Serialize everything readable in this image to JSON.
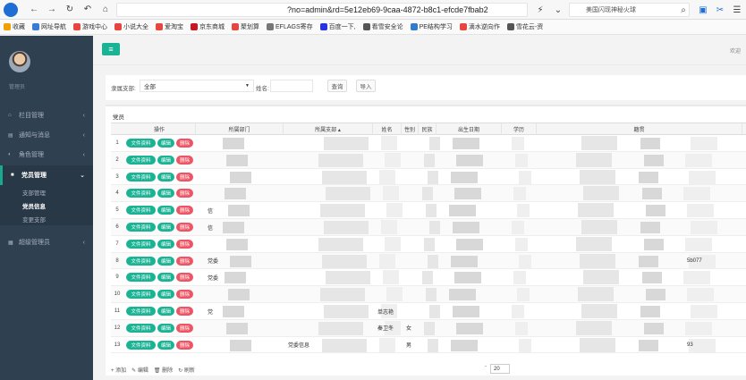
{
  "browser": {
    "address": "?no=admin&rd=5e12eb69-9caa-4872-b8c1-efcde7fbab2",
    "search_placeholder": "美国闪现神秘火球",
    "bookmarks": [
      {
        "label": "收藏",
        "color": "#f0a000"
      },
      {
        "label": "网址导航",
        "color": "#3a7bd5"
      },
      {
        "label": "游戏中心",
        "color": "#e8453c"
      },
      {
        "label": "小说大全",
        "color": "#e8453c"
      },
      {
        "label": "爱淘宝",
        "color": "#e8453c"
      },
      {
        "label": "京东商城",
        "color": "#c81623"
      },
      {
        "label": "聚划算",
        "color": "#e8453c"
      },
      {
        "label": "EFLAGS寄存",
        "color": "#777777"
      },
      {
        "label": "百度一下,",
        "color": "#2932e1"
      },
      {
        "label": "看雪安全论",
        "color": "#555555"
      },
      {
        "label": "PE结构学习",
        "color": "#2e7bcf"
      },
      {
        "label": "滴水逆向作",
        "color": "#e8453c"
      },
      {
        "label": "雪花云-资",
        "color": "#555555"
      }
    ]
  },
  "sidebar": {
    "user_role": "管理员",
    "menu": [
      {
        "label": "栏目管理",
        "icon": "home-icon"
      },
      {
        "label": "通知与消息",
        "icon": "bell-icon"
      },
      {
        "label": "角色管理",
        "icon": "user-icon"
      },
      {
        "label": "党员管理",
        "icon": "list-icon"
      },
      {
        "label": "超级管理员",
        "icon": "user-shield-icon"
      }
    ],
    "submenu": [
      "支部管理",
      "党员信息",
      "变更支部"
    ]
  },
  "topbar": {
    "toggle_icon": "menu-icon",
    "welcome": "欢迎"
  },
  "filter": {
    "branch_label": "隶属支部:",
    "branch_value": "全部",
    "name_label": "姓名:",
    "query_button": "查询",
    "import_button": "导入"
  },
  "grid": {
    "title": "党员",
    "columns": [
      "操作",
      "所属部门",
      "所属支部 ▴",
      "姓名",
      "性别",
      "民族",
      "出生日期",
      "学历",
      "籍贯"
    ],
    "action_labels": {
      "doc": "文件资料",
      "edit": "编辑",
      "delete": "删除"
    },
    "rows": [
      {
        "n": "1",
        "dept": "",
        "branch": "",
        "name": "",
        "gender": "",
        "nation": "",
        "extra": ""
      },
      {
        "n": "2",
        "dept": "",
        "branch": "",
        "name": "",
        "gender": "",
        "nation": "",
        "extra": ""
      },
      {
        "n": "3",
        "dept": "",
        "branch": "",
        "name": "",
        "gender": "",
        "nation": "",
        "extra": ""
      },
      {
        "n": "4",
        "dept": "",
        "branch": "",
        "name": "",
        "gender": "",
        "nation": "",
        "extra": ""
      },
      {
        "n": "5",
        "dept": "信",
        "branch": "",
        "name": "",
        "gender": "",
        "nation": "",
        "extra": ""
      },
      {
        "n": "6",
        "dept": "信",
        "branch": "",
        "name": "",
        "gender": "",
        "nation": "",
        "extra": ""
      },
      {
        "n": "7",
        "dept": "",
        "branch": "",
        "name": "",
        "gender": "",
        "nation": "",
        "extra": ""
      },
      {
        "n": "8",
        "dept": "党委",
        "branch": "",
        "name": "",
        "gender": "",
        "nation": "",
        "extra": "5b077"
      },
      {
        "n": "9",
        "dept": "党委",
        "branch": "",
        "name": "",
        "gender": "",
        "nation": "",
        "extra": ""
      },
      {
        "n": "10",
        "dept": "",
        "branch": "",
        "name": "",
        "gender": "",
        "nation": "",
        "extra": ""
      },
      {
        "n": "11",
        "dept": "党",
        "branch": "",
        "name": "单志艳",
        "gender": "",
        "nation": "",
        "extra": ""
      },
      {
        "n": "12",
        "dept": "",
        "branch": "",
        "name": "秦卫冬",
        "gender": "女",
        "nation": "",
        "extra": ""
      },
      {
        "n": "13",
        "dept": "",
        "branch": "党委信息",
        "name": "",
        "gender": "男",
        "nation": "",
        "extra": "93"
      }
    ]
  },
  "footer": {
    "add": "+ 添加",
    "edit": "✎ 编辑",
    "delete": "🗑 删除",
    "refresh": "↻ 刷新",
    "page_prefix": "-",
    "page_size": "20"
  }
}
